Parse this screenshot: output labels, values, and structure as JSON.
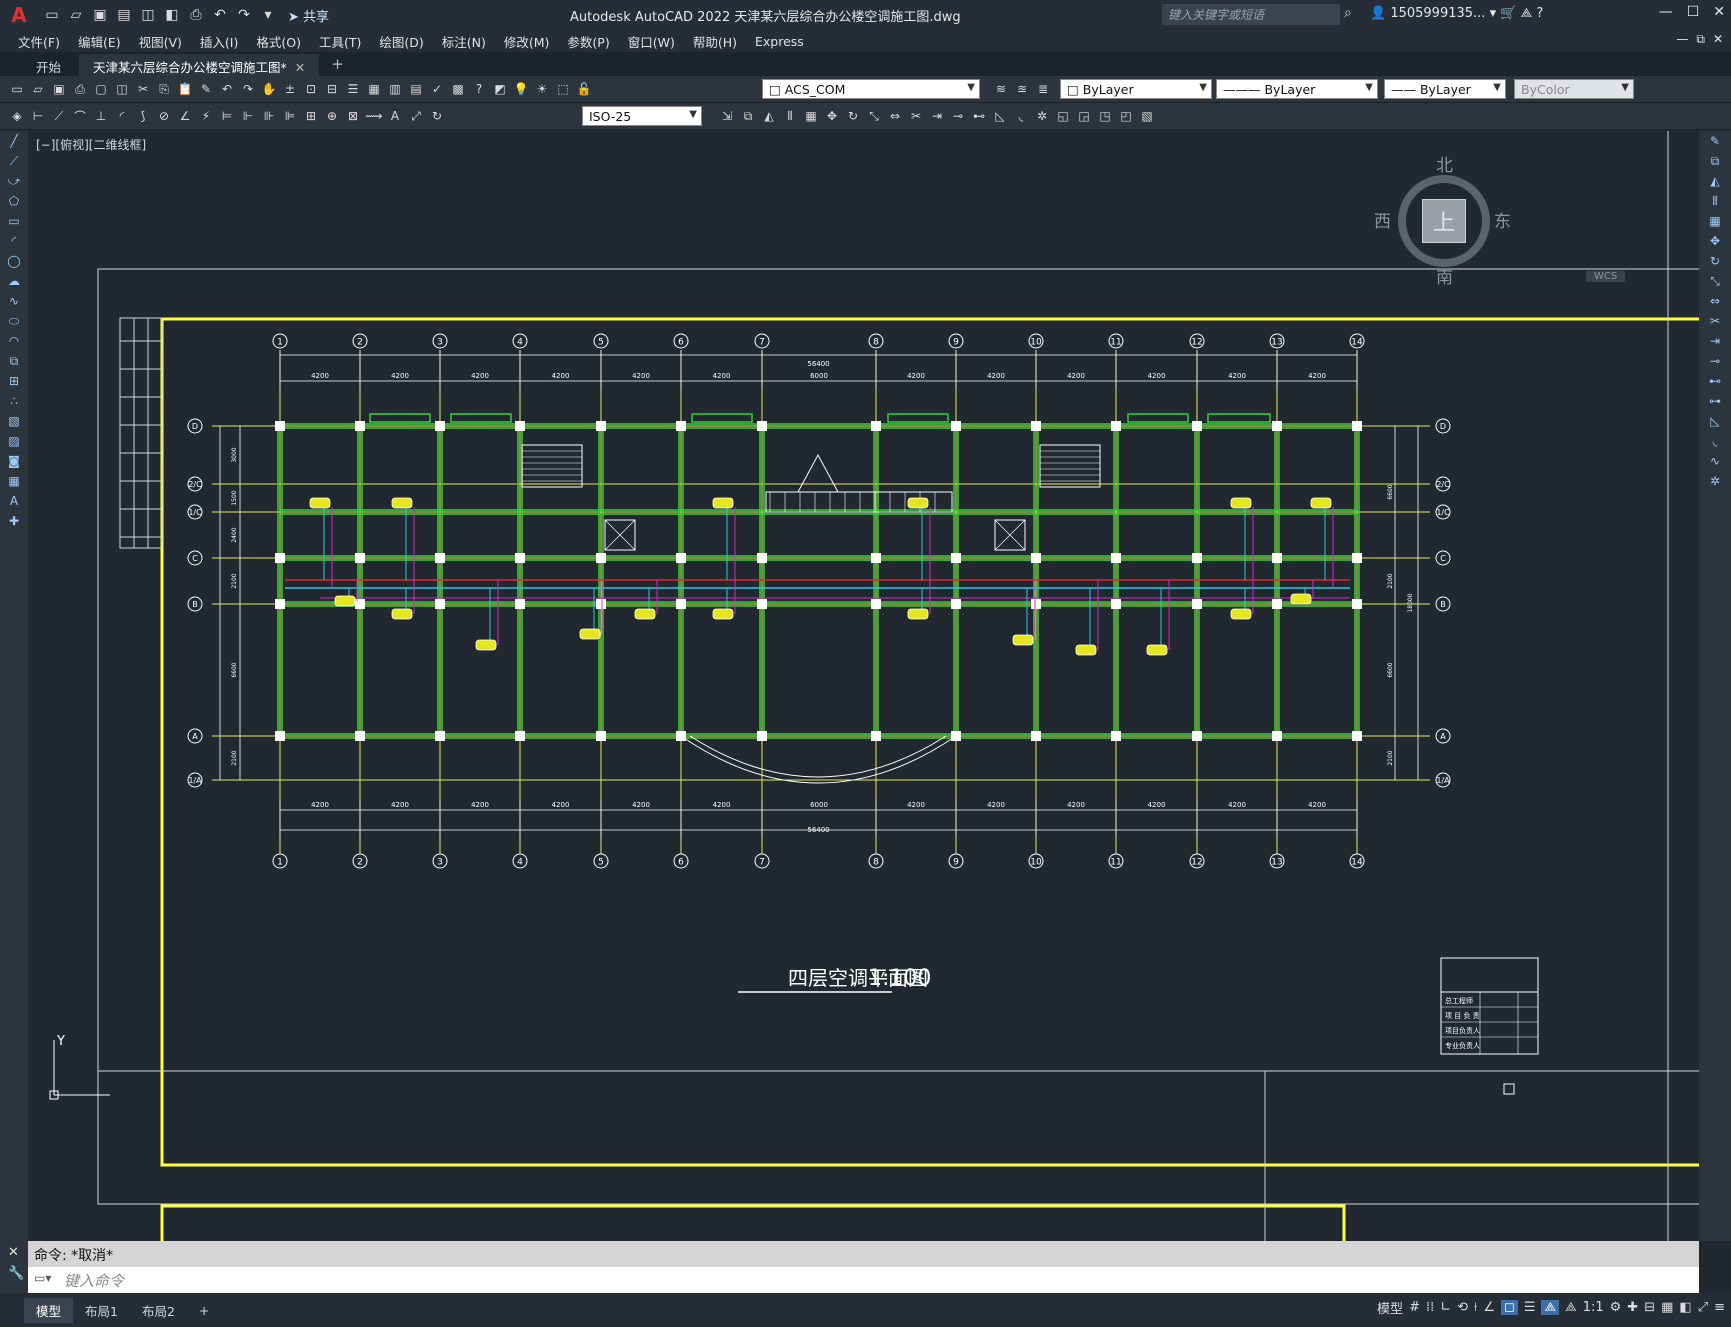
{
  "app": {
    "title": "Autodesk AutoCAD 2022    天津某六层综合办公楼空调施工图.dwg",
    "share_label": "共享",
    "search_placeholder": "键入关键字或短语",
    "user": "1505999135... ▾",
    "logo": "A"
  },
  "menu": [
    "文件(F)",
    "编辑(E)",
    "视图(V)",
    "插入(I)",
    "格式(O)",
    "工具(T)",
    "绘图(D)",
    "标注(N)",
    "修改(M)",
    "参数(P)",
    "窗口(W)",
    "帮助(H)",
    "Express"
  ],
  "tabs": [
    {
      "label": "开始",
      "active": false
    },
    {
      "label": "天津某六层综合办公楼空调施工图*",
      "active": true,
      "close": "✕"
    }
  ],
  "tab_add": "+",
  "toolbar": {
    "layer": "ACS_COM",
    "color": "ByLayer",
    "linetype": "ByLayer",
    "lineweight": "ByLayer",
    "plotstyle": "ByColor",
    "dimstyle": "ISO-25"
  },
  "viewport_label": "[−][俯视][二维线框]",
  "viewcube": {
    "north": "北",
    "south": "南",
    "east": "东",
    "west": "西",
    "top": "上",
    "wcs": "WCS"
  },
  "drawing": {
    "title": "四层空调平面图",
    "scale": "1:100",
    "axes_top": [
      "1",
      "2",
      "3",
      "4",
      "5",
      "6",
      "7",
      "8",
      "9",
      "10",
      "11",
      "12",
      "13",
      "14"
    ],
    "axes_side": [
      "D",
      "2/C",
      "1/C",
      "C",
      "B",
      "A",
      "1/A"
    ],
    "dims_top": [
      "4200",
      "4200",
      "4200",
      "4200",
      "4200",
      "4200",
      "6000",
      "4200",
      "4200",
      "4200",
      "4200",
      "4200",
      "4200"
    ],
    "dim_total": "56400",
    "dims_left": [
      "3000",
      "1500",
      "2400",
      "2100",
      "6600",
      "2100"
    ],
    "dim_right_upper": "6600",
    "dim_right_mid": "2100",
    "dim_right_total": "18000",
    "dim_right_lower": "6600",
    "dim_right_bottom": "2100",
    "titleblock": [
      "总工程师",
      "项 目 负 责",
      "项目负责人",
      "专业负责人"
    ]
  },
  "command": {
    "history": "命令: *取消*",
    "input_placeholder": "键入命令"
  },
  "layout_tabs": [
    "模型",
    "布局1",
    "布局2"
  ],
  "layout_add": "+",
  "status": {
    "model": "模型",
    "scale": "1:1"
  },
  "colors": {
    "background": "#212830",
    "wall": "#32d232",
    "axis": "#e6e65a",
    "border": "#ffff3c",
    "pipe_red": "#e02828",
    "pipe_cyan": "#28c8e0",
    "pipe_magenta": "#d228d2"
  }
}
